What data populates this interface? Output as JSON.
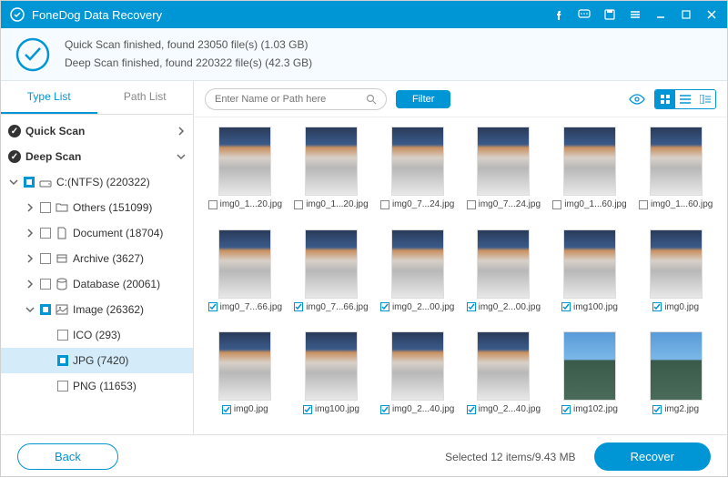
{
  "app": {
    "title": "FoneDog Data Recovery"
  },
  "status": {
    "line1": "Quick Scan finished, found 23050 file(s) (1.03 GB)",
    "line2": "Deep Scan finished, found 220322 file(s) (42.3 GB)"
  },
  "sidebar": {
    "tabs": {
      "type_list": "Type List",
      "path_list": "Path List"
    },
    "quick_scan": "Quick Scan",
    "deep_scan": "Deep Scan",
    "drive": "C:(NTFS) (220322)",
    "others": "Others (151099)",
    "document": "Document (18704)",
    "archive": "Archive (3627)",
    "database": "Database (20061)",
    "image": "Image (26362)",
    "ico": "ICO (293)",
    "jpg": "JPG (7420)",
    "png": "PNG (11653)"
  },
  "toolbar": {
    "search_placeholder": "Enter Name or Path here",
    "filter": "Filter"
  },
  "grid": {
    "items": [
      {
        "name": "img0_1...20.jpg",
        "checked": false,
        "variant": "sky"
      },
      {
        "name": "img0_1...20.jpg",
        "checked": false,
        "variant": "sky"
      },
      {
        "name": "img0_7...24.jpg",
        "checked": false,
        "variant": "sky"
      },
      {
        "name": "img0_7...24.jpg",
        "checked": false,
        "variant": "sky"
      },
      {
        "name": "img0_1...60.jpg",
        "checked": false,
        "variant": "sky"
      },
      {
        "name": "img0_1...60.jpg",
        "checked": false,
        "variant": "sky"
      },
      {
        "name": "img0_7...66.jpg",
        "checked": true,
        "variant": "sky"
      },
      {
        "name": "img0_7...66.jpg",
        "checked": true,
        "variant": "sky"
      },
      {
        "name": "img0_2...00.jpg",
        "checked": true,
        "variant": "sky"
      },
      {
        "name": "img0_2...00.jpg",
        "checked": true,
        "variant": "sky"
      },
      {
        "name": "img100.jpg",
        "checked": true,
        "variant": "sky"
      },
      {
        "name": "img0.jpg",
        "checked": true,
        "variant": "sky"
      },
      {
        "name": "img0.jpg",
        "checked": true,
        "variant": "sky"
      },
      {
        "name": "img100.jpg",
        "checked": true,
        "variant": "sky"
      },
      {
        "name": "img0_2...40.jpg",
        "checked": true,
        "variant": "sky"
      },
      {
        "name": "img0_2...40.jpg",
        "checked": true,
        "variant": "sky"
      },
      {
        "name": "img102.jpg",
        "checked": true,
        "variant": "wide"
      },
      {
        "name": "img2.jpg",
        "checked": true,
        "variant": "wide"
      }
    ]
  },
  "footer": {
    "back": "Back",
    "selected": "Selected 12 items/9.43 MB",
    "recover": "Recover"
  }
}
